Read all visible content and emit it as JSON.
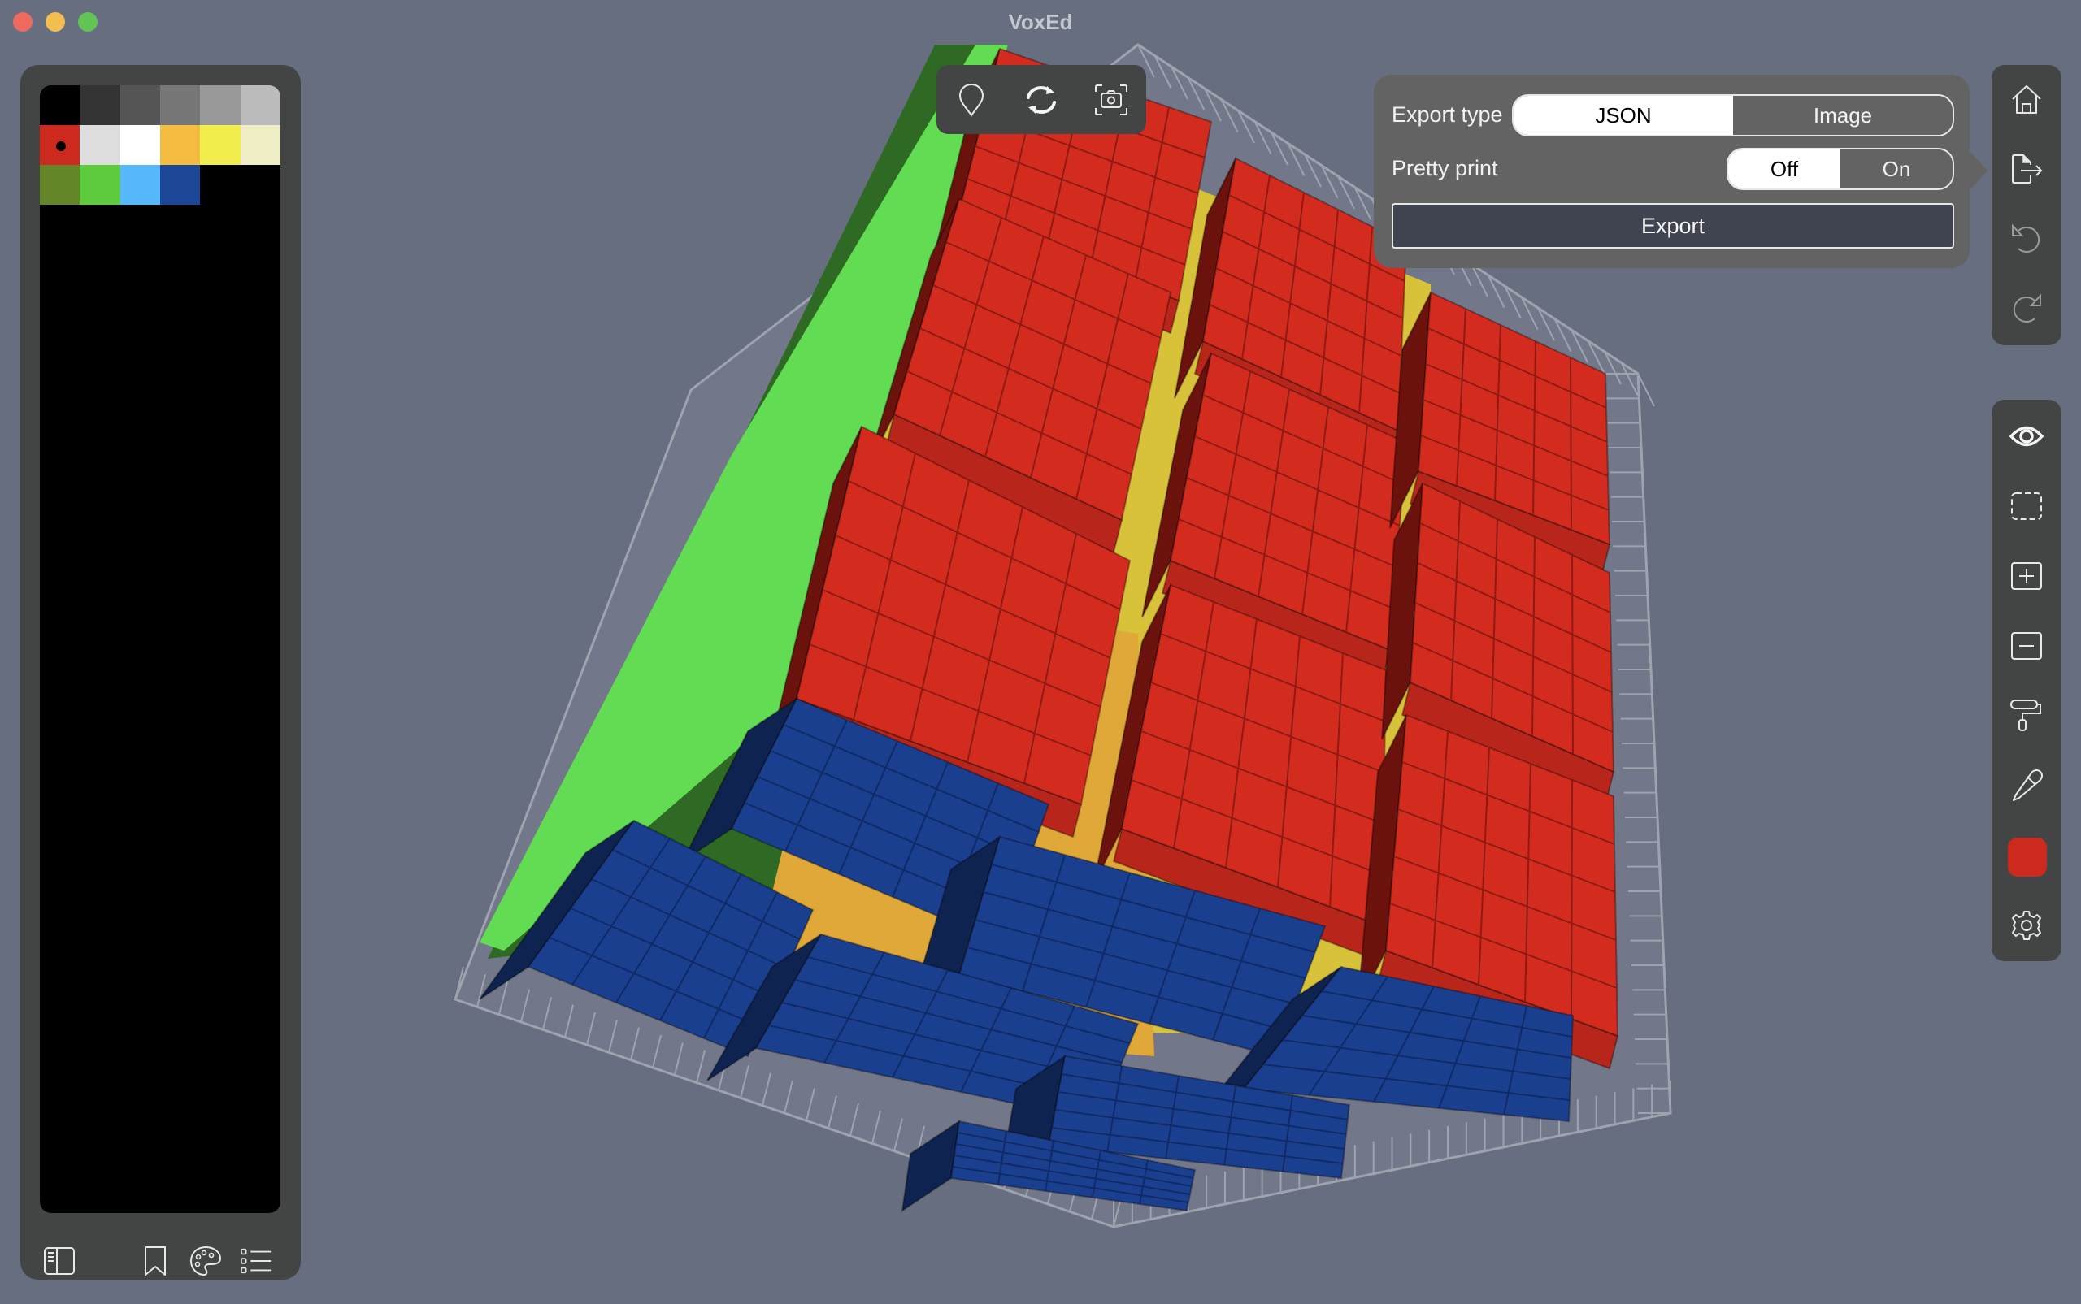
{
  "window": {
    "title": "VoxEd",
    "controls": [
      "close",
      "minimize",
      "maximize"
    ]
  },
  "palette": {
    "selected_index": 6,
    "swatches": [
      "#000000",
      "#343434",
      "#555555",
      "#777777",
      "#999999",
      "#bbbbbb",
      "#cc2a1f",
      "#dddddd",
      "#ffffff",
      "#f4bd42",
      "#f0ed4c",
      "#f0eec6",
      "#648628",
      "#5dcb3d",
      "#57b9fc",
      "#1c4796"
    ],
    "bottom_icons": [
      "sidebar-icon",
      "bookmark-icon",
      "palette-icon",
      "list-icon"
    ]
  },
  "top_toolbar": {
    "icons": [
      "location-pin-icon",
      "rotate-icon",
      "screenshot-icon"
    ]
  },
  "export_popover": {
    "export_type_label": "Export type",
    "export_type_options": [
      "JSON",
      "Image"
    ],
    "export_type_selected": "JSON",
    "pretty_print_label": "Pretty print",
    "pretty_print_options": [
      "Off",
      "On"
    ],
    "pretty_print_selected": "Off",
    "export_button": "Export"
  },
  "right_toolbar": {
    "group1": [
      "home-icon",
      "export-icon",
      "undo-icon",
      "redo-icon"
    ],
    "group2": [
      "eye-icon",
      "select-icon",
      "add-voxel-icon",
      "remove-voxel-icon",
      "paint-roller-icon",
      "eyedropper-icon",
      "current-color",
      "settings-icon"
    ],
    "current_color": "#cc2a1f"
  },
  "scene": {
    "face_colors": {
      "top": "#d42b1f",
      "left": "#62dc52",
      "bottom": "#1b3f8f",
      "inner": "#d8c23a",
      "floor_grid": "#8a8f9c"
    }
  }
}
